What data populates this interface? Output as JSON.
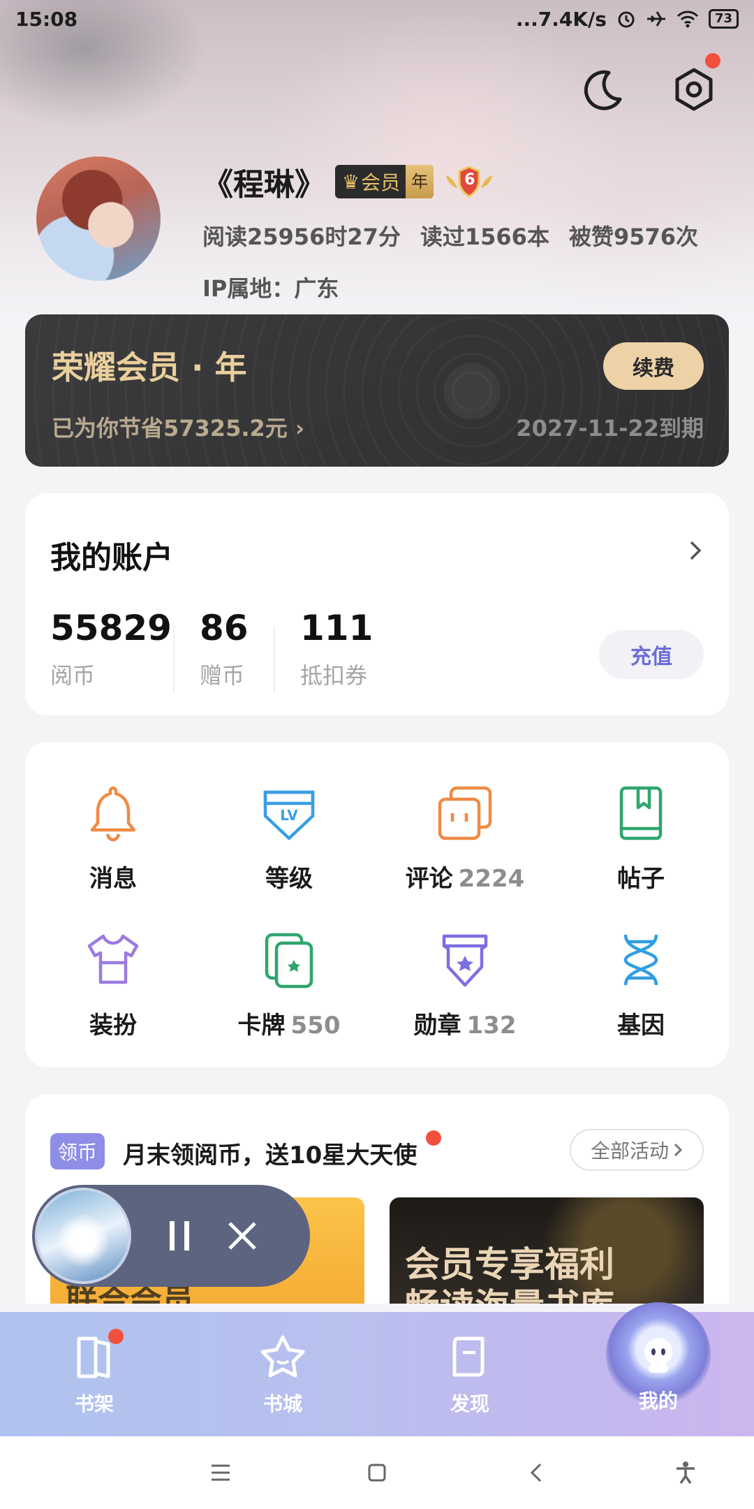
{
  "status_bar": {
    "time": "15:08",
    "network_speed": "...7.4K/s",
    "battery": "73",
    "icons": [
      "alarm-icon",
      "airplane-icon",
      "wifi-icon",
      "battery-icon"
    ]
  },
  "top_actions": {
    "night_mode_icon": "moon-icon",
    "settings_icon": "gear-icon",
    "settings_has_dot": true
  },
  "profile": {
    "name": "《程琳》",
    "vip_badge_text": "会员",
    "vip_badge_suffix": "年",
    "level": "6",
    "reading_time": "阅读25956时27分",
    "books_read": "读过1566本",
    "likes": "被赞9576次",
    "ip_location": "IP属地：广东"
  },
  "vip_card": {
    "title": "荣耀会员 · 年",
    "renew_label": "续费",
    "saved_text": "已为你节省57325.2元 ›",
    "expire_text": "2027-11-22到期"
  },
  "account": {
    "title": "我的账户",
    "items": [
      {
        "value": "55829",
        "label": "阅币"
      },
      {
        "value": "86",
        "label": "赠币"
      },
      {
        "value": "111",
        "label": "抵扣券"
      }
    ],
    "recharge_label": "充值"
  },
  "features": {
    "items": [
      {
        "label": "消息",
        "count": "",
        "icon": "bell-icon",
        "color": "#f08a45"
      },
      {
        "label": "等级",
        "count": "",
        "icon": "level-shield-icon",
        "color": "#3a9ee4"
      },
      {
        "label": "评论",
        "count": "2224",
        "icon": "comment-icon",
        "color": "#f08a45"
      },
      {
        "label": "帖子",
        "count": "",
        "icon": "bookmark-book-icon",
        "color": "#2fa56d"
      },
      {
        "label": "装扮",
        "count": "",
        "icon": "tshirt-icon",
        "color": "#9b7be0"
      },
      {
        "label": "卡牌",
        "count": "550",
        "icon": "cards-icon",
        "color": "#2fa56d"
      },
      {
        "label": "勋章",
        "count": "132",
        "icon": "medal-icon",
        "color": "#7c6fe0"
      },
      {
        "label": "基因",
        "count": "",
        "icon": "dna-icon",
        "color": "#2f9ee4"
      }
    ]
  },
  "activity": {
    "tag": "领币",
    "title": "月末领阅币，送10星大天使",
    "all_label": "全部活动",
    "banner_left_text": "联合会员",
    "banner_right_line1": "会员专享福利",
    "banner_right_line2": "畅读海量书库"
  },
  "player": {
    "pause_icon": "pause-icon",
    "close_icon": "close-icon"
  },
  "bottom_nav": {
    "items": [
      {
        "label": "书架",
        "icon": "bookshelf-icon",
        "has_dot": true
      },
      {
        "label": "书城",
        "icon": "star-icon",
        "has_dot": false
      },
      {
        "label": "发现",
        "icon": "discover-icon",
        "has_dot": false
      },
      {
        "label": "我的",
        "icon": "mine-avatar-icon",
        "has_dot": false,
        "active": true
      }
    ]
  },
  "system_nav": {
    "icons": [
      "menu-icon",
      "home-icon",
      "back-icon",
      "accessibility-icon"
    ]
  }
}
